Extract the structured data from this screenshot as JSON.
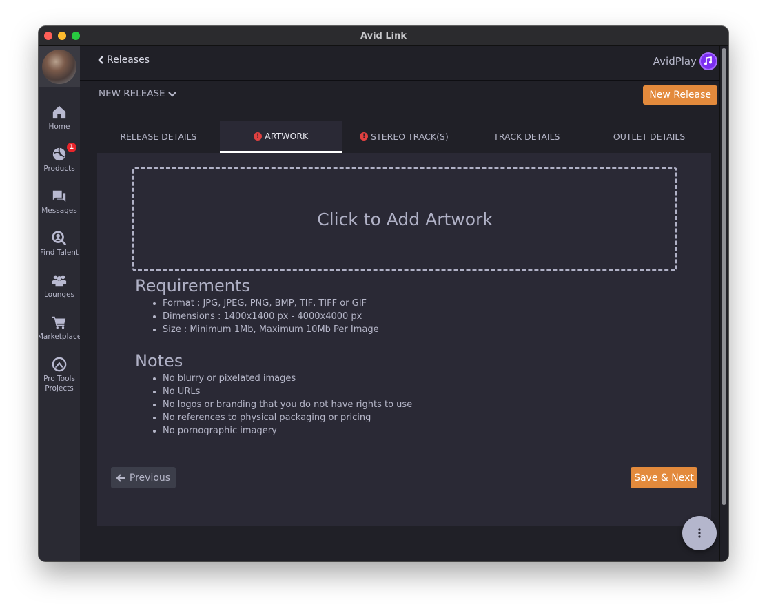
{
  "window": {
    "title": "Avid Link"
  },
  "sidebar": {
    "items": [
      {
        "label": "Home",
        "icon": "home-icon"
      },
      {
        "label": "Products",
        "icon": "products-icon",
        "badge": "1"
      },
      {
        "label": "Messages",
        "icon": "messages-icon"
      },
      {
        "label": "Find Talent",
        "icon": "find-talent-icon"
      },
      {
        "label": "Lounges",
        "icon": "lounges-icon"
      },
      {
        "label": "Marketplace",
        "icon": "cart-icon"
      },
      {
        "label": "Pro Tools Projects",
        "icon": "pro-tools-icon"
      }
    ]
  },
  "header": {
    "back_label": "Releases",
    "brand": "AvidPlay",
    "release_dropdown": "NEW RELEASE",
    "new_release_button": "New Release"
  },
  "tabs": [
    {
      "label": "RELEASE DETAILS",
      "warning": false,
      "active": false
    },
    {
      "label": "ARTWORK",
      "warning": true,
      "active": true
    },
    {
      "label": "STEREO TRACK(S)",
      "warning": true,
      "active": false
    },
    {
      "label": "TRACK DETAILS",
      "warning": false,
      "active": false
    },
    {
      "label": "OUTLET DETAILS",
      "warning": false,
      "active": false
    }
  ],
  "artwork": {
    "dropzone_label": "Click to Add Artwork",
    "requirements_title": "Requirements",
    "requirements": [
      "Format : JPG, JPEG, PNG, BMP, TIF, TIFF or GIF",
      "Dimensions : 1400x1400 px - 4000x4000 px",
      "Size : Minimum 1Mb, Maximum 10Mb Per Image"
    ],
    "notes_title": "Notes",
    "notes": [
      "No blurry or pixelated images",
      "No URLs",
      "No logos or branding that you do not have rights to use",
      "No references to physical packaging or pricing",
      "No pornographic imagery"
    ]
  },
  "footer": {
    "previous_label": "Previous",
    "save_next_label": "Save & Next"
  },
  "colors": {
    "accent": "#e38a3c",
    "warning": "#e04040",
    "brand": "#7c2ff0"
  }
}
